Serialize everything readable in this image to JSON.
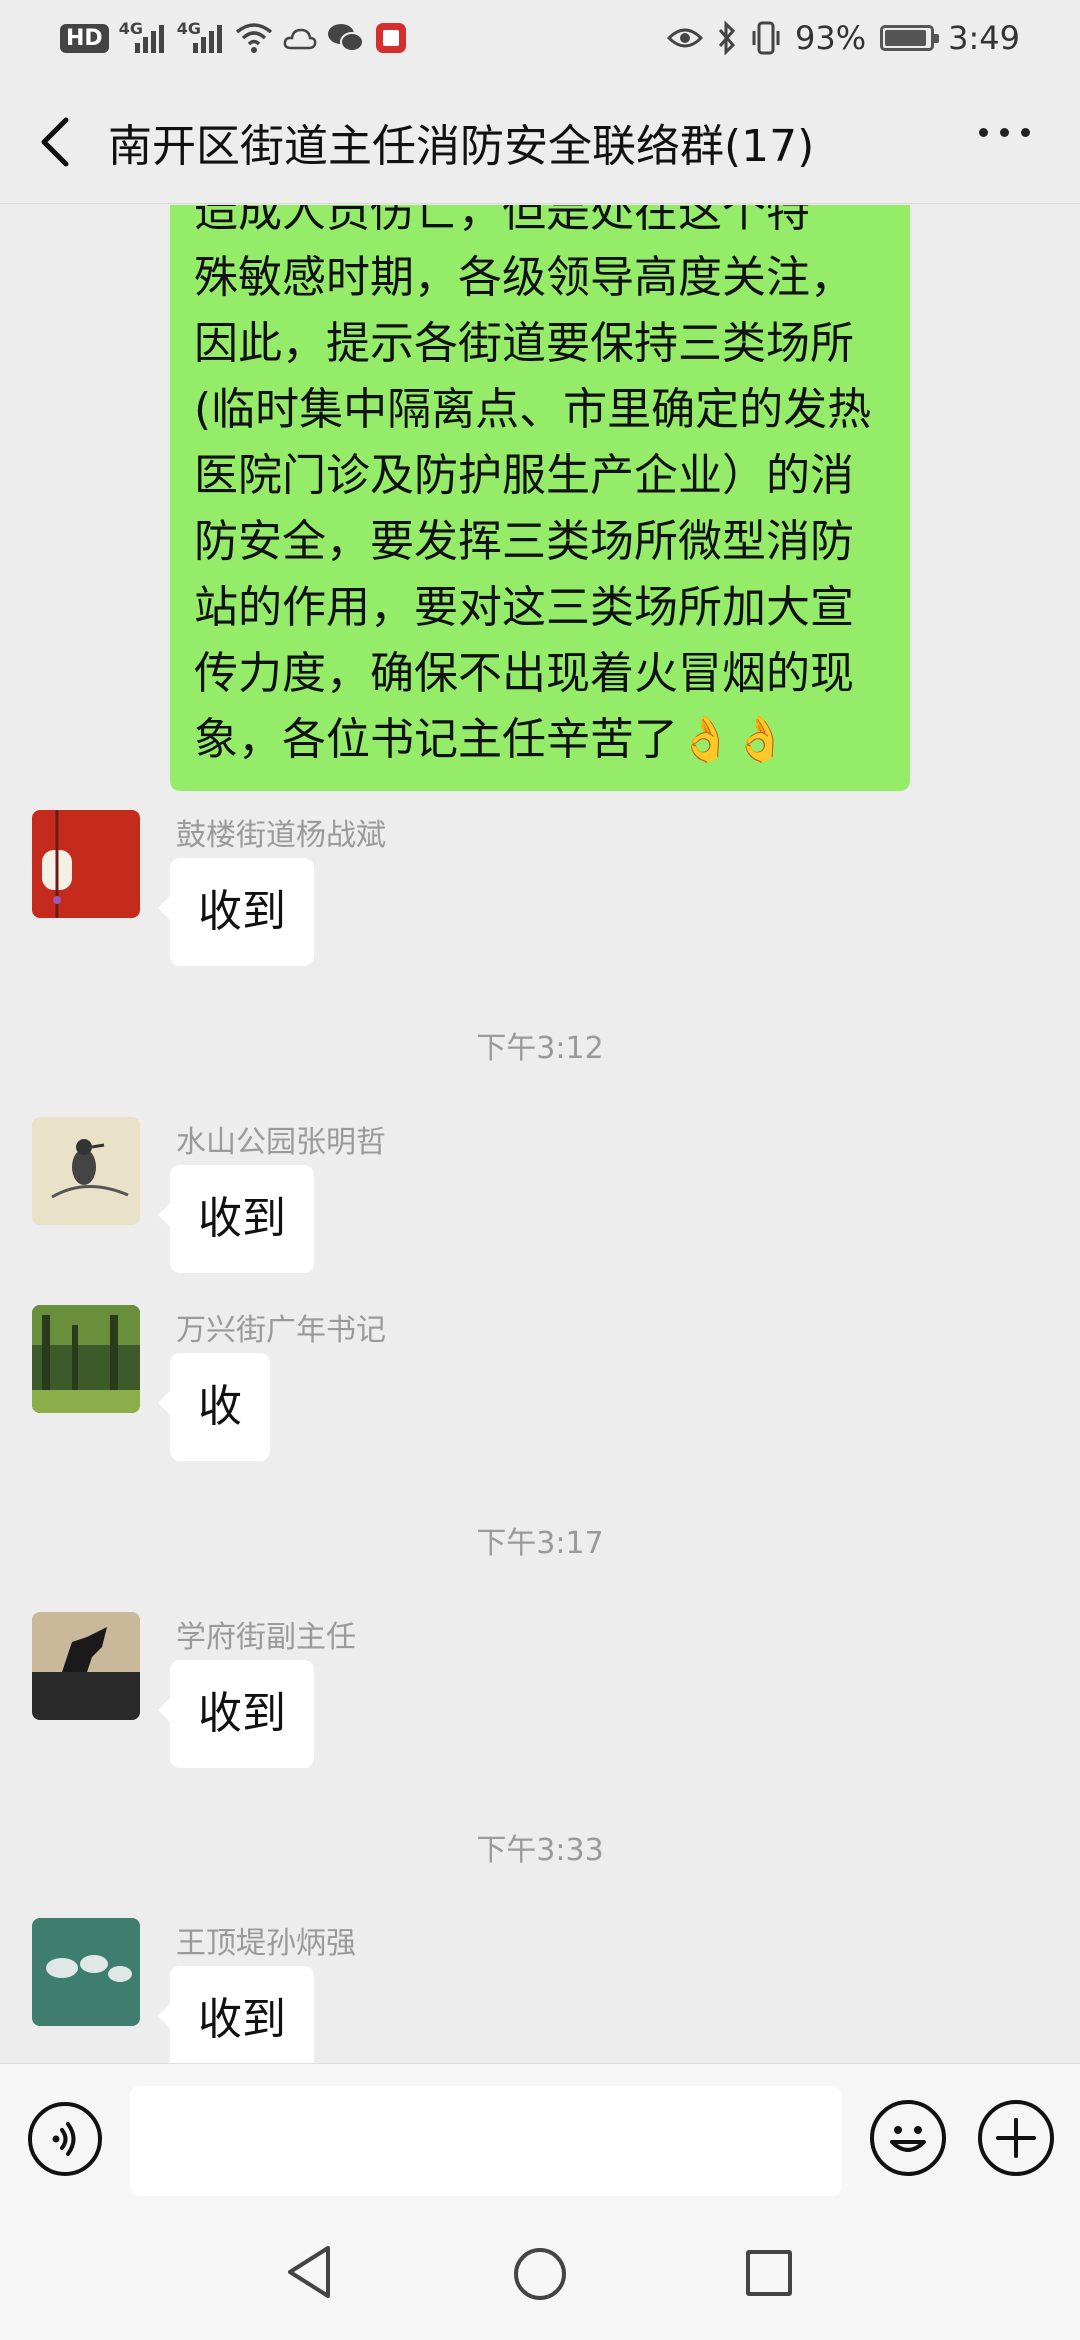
{
  "status_bar": {
    "hd_label": "HD",
    "net1": "4G",
    "net2": "4G",
    "battery_percent": "93%",
    "battery_level": 0.93,
    "time": "3:49",
    "icons": [
      "hd-icon",
      "signal-icon",
      "wifi-icon",
      "weather-icon",
      "wechat-icon",
      "app-icon",
      "eye-icon",
      "bluetooth-icon",
      "vibrate-icon",
      "battery-icon"
    ]
  },
  "header": {
    "title": "南开区街道主任消防安全联络群(17)",
    "back_icon": "chevron-left-icon",
    "more_icon": "more-dots-icon"
  },
  "chat": {
    "own_message": {
      "text": "造成人员伤亡，但是处在这个特\n殊敏感时期，各级领导高度关注，\n因此，提示各街道要保持三类场所\n(临时集中隔离点、市里确定的发热\n医院门诊及防护服生产企业）的消\n防安全，要发挥三类场所微型消防\n站的作用，要对这三类场所加大宣\n传力度，确保不出现着火冒烟的现\n象，各位书记主任辛苦了",
      "emoji": "👌👌"
    },
    "messages": [
      {
        "sender": "鼓楼街道杨战斌",
        "text": "收到"
      },
      {
        "sender": "水山公园张明哲",
        "text": "收到"
      },
      {
        "sender": "万兴街广年书记",
        "text": "收"
      },
      {
        "sender": "学府街副主任",
        "text": "收到"
      },
      {
        "sender": "王顶堤孙炳强",
        "text": "收到"
      }
    ],
    "timestamps": [
      "下午3:12",
      "下午3:17",
      "下午3:33"
    ],
    "avatar_colors": {
      "a0": "#c42b1c",
      "a1": "#e9e1c8",
      "a2": "#3d5a2a",
      "a3": "#2a2a2a",
      "a4": "#3f7d6e"
    }
  },
  "input_bar": {
    "placeholder": "",
    "value": "",
    "icons": [
      "voice-icon",
      "emoji-icon",
      "plus-icon"
    ]
  },
  "nav_bar": {
    "icons": [
      "nav-back-icon",
      "nav-home-icon",
      "nav-recent-icon"
    ]
  }
}
